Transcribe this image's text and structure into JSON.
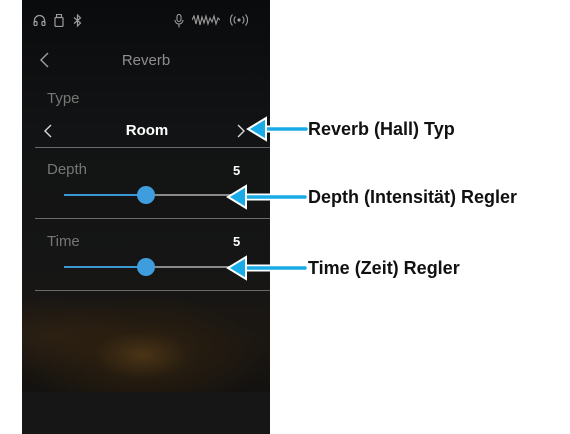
{
  "status_bar": {
    "icons": [
      "headphones-icon",
      "usb-icon",
      "bluetooth-icon",
      "microphone-icon",
      "audio-wave-icon",
      "wireless-icon"
    ],
    "icon_color": "#9c9c9c"
  },
  "header": {
    "title": "Reverb",
    "back_icon": "chevron-left-icon"
  },
  "type_section": {
    "label": "Type",
    "value": "Room",
    "prev_icon": "chevron-left-icon",
    "next_icon": "chevron-right-icon"
  },
  "depth": {
    "label": "Depth",
    "value": "5",
    "level": 0.4
  },
  "time": {
    "label": "Time",
    "value": "5",
    "level": 0.4
  },
  "annotations": [
    {
      "text": "Reverb (Hall) Typ"
    },
    {
      "text": "Depth (Intensität) Regler"
    },
    {
      "text": "Time (Zeit) Regler"
    }
  ],
  "colors": {
    "accent": "#3e9ddd",
    "callout_arrow": "#1aabe6",
    "label_text": "#767676",
    "value_text": "#ffffff"
  }
}
